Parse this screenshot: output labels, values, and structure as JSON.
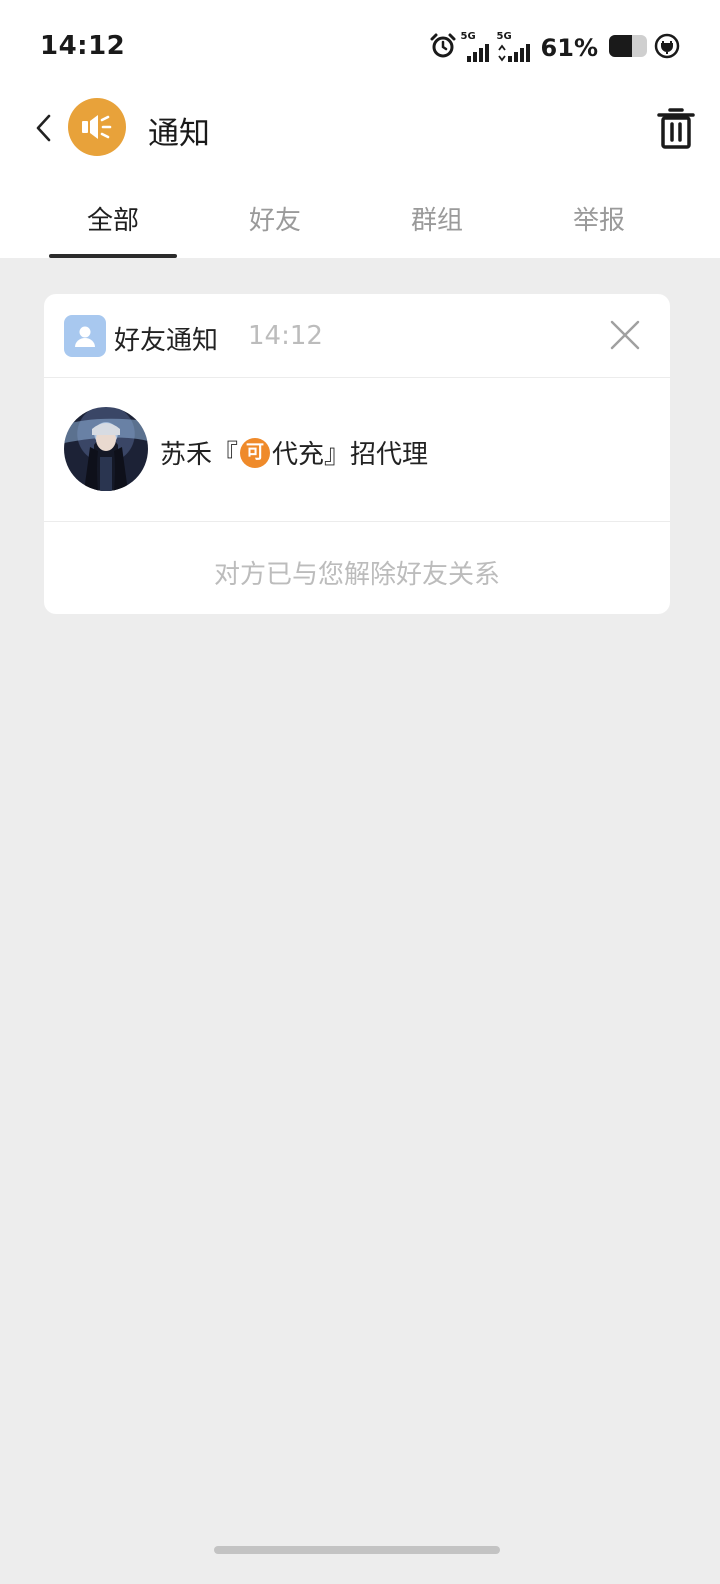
{
  "status_bar": {
    "time": "14:12",
    "network_1": "5G",
    "network_2": "5G",
    "battery": "61%",
    "icons": [
      "alarm-icon",
      "signal-icon",
      "signal-icon",
      "battery-icon",
      "charging-icon"
    ]
  },
  "header": {
    "title": "通知",
    "avatar_icon": "speaker-icon",
    "avatar_color": "#e8a23a",
    "back_icon": "chevron-left-icon",
    "trash_icon": "trash-icon"
  },
  "tabs": [
    {
      "label": "全部",
      "active": true
    },
    {
      "label": "好友",
      "active": false
    },
    {
      "label": "群组",
      "active": false
    },
    {
      "label": "举报",
      "active": false
    }
  ],
  "notification": {
    "category": "好友通知",
    "time": "14:12",
    "icon": "user-icon",
    "close_icon": "close-icon",
    "user_name_prefix": "苏禾『",
    "user_name_badge": "可",
    "user_name_suffix": "代充』招代理",
    "message": "对方已与您解除好友关系",
    "badge_color": "#ef8a2a",
    "icon_color": "#a8c8ef"
  }
}
